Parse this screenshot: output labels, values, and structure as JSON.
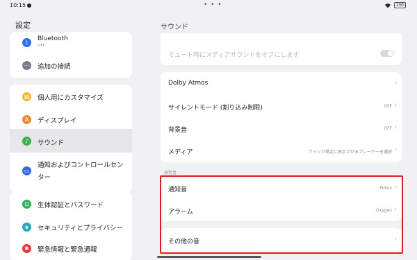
{
  "status_bar": {
    "time": "10:15",
    "battery": "100"
  },
  "left_panel": {
    "title": "設定",
    "card1": [
      {
        "label": "Bluetooth",
        "sublabel": "OFF",
        "icon": "bluetooth-icon",
        "color": "#2f6fea"
      },
      {
        "label": "追加の接続",
        "icon": "more-dots-icon",
        "color": "#7b7b8c"
      }
    ],
    "card2": [
      {
        "label": "個人用にカスタマイズ",
        "icon": "palette-icon",
        "color": "#f2b632"
      },
      {
        "label": "ディスプレイ",
        "icon": "display-icon",
        "color": "#f0892f"
      },
      {
        "label": "サウンド",
        "icon": "speaker-icon",
        "color": "#3fb04c",
        "selected": true
      },
      {
        "label": "通知およびコントロールセン",
        "label2": "ター",
        "icon": "notification-icon",
        "color": "#3866e4"
      }
    ],
    "card3": [
      {
        "label": "生体認証とパスワード",
        "icon": "lock-icon",
        "color": "#2fb15a"
      },
      {
        "label": "セキュリティとプライバシー",
        "icon": "shield-icon",
        "color": "#2aa6b9"
      },
      {
        "label": "緊急情報と緊急通報",
        "icon": "emergency-icon",
        "color": "#e5383b"
      }
    ]
  },
  "right_panel": {
    "title": "サウンド",
    "mute_row": {
      "label": "ミュート時にメディアサウンドをオフにします",
      "toggle": false
    },
    "group1": [
      {
        "label": "Dolby Atmos",
        "value": ""
      },
      {
        "label": "サイレントモード (割り込み制限)",
        "value": "OFF"
      },
      {
        "label": "背景音",
        "value": "OFF"
      },
      {
        "label": "メディア",
        "value": "クイック設定に表示させるプレーヤーを選択"
      }
    ],
    "section_label": "着信音",
    "group2": [
      {
        "label": "通知音",
        "value": "Pollux"
      },
      {
        "label": "アラーム",
        "value": "Oxygen"
      }
    ],
    "group3": [
      {
        "label": "その他の音",
        "value": ""
      }
    ]
  },
  "colors": {
    "highlight": "#e02020",
    "background": "#f1f1f3"
  }
}
